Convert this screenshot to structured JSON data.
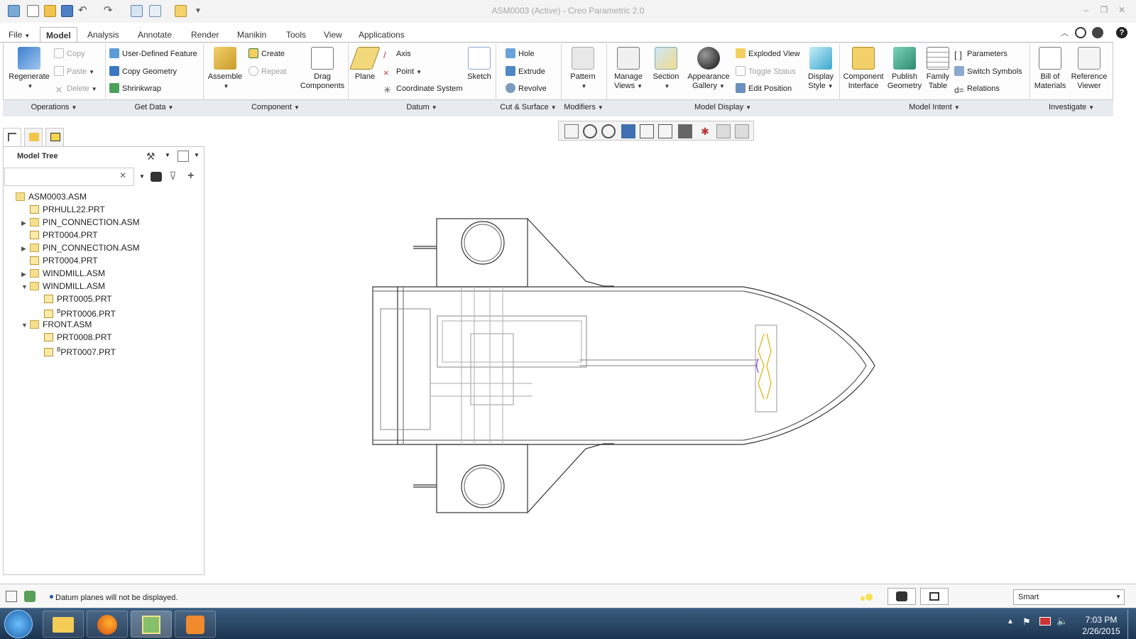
{
  "window": {
    "title": "ASM0003 (Active) - Creo Parametric 2.0"
  },
  "tabs": [
    {
      "label": "File",
      "active": false
    },
    {
      "label": "Model",
      "active": true
    },
    {
      "label": "Analysis",
      "active": false
    },
    {
      "label": "Annotate",
      "active": false
    },
    {
      "label": "Render",
      "active": false
    },
    {
      "label": "Manikin",
      "active": false
    },
    {
      "label": "Tools",
      "active": false
    },
    {
      "label": "View",
      "active": false
    },
    {
      "label": "Applications",
      "active": false
    }
  ],
  "ribbon": {
    "regenerate": "Regenerate",
    "copy": "Copy",
    "paste": "Paste",
    "delete": "Delete",
    "user_defined_feature": "User-Defined Feature",
    "copy_geometry": "Copy Geometry",
    "shrinkwrap": "Shrinkwrap",
    "assemble": "Assemble",
    "create": "Create",
    "repeat": "Repeat",
    "drag_components_1": "Drag",
    "drag_components_2": "Components",
    "plane": "Plane",
    "axis": "Axis",
    "point": "Point",
    "coordinate_system": "Coordinate System",
    "sketch": "Sketch",
    "hole": "Hole",
    "extrude": "Extrude",
    "revolve": "Revolve",
    "pattern": "Pattern",
    "manage_views_1": "Manage",
    "manage_views_2": "Views",
    "section": "Section",
    "appearance_gallery_1": "Appearance",
    "appearance_gallery_2": "Gallery",
    "exploded_view": "Exploded View",
    "toggle_status": "Toggle Status",
    "edit_position": "Edit Position",
    "display_style_1": "Display",
    "display_style_2": "Style",
    "component_interface_1": "Component",
    "component_interface_2": "Interface",
    "publish_geometry_1": "Publish",
    "publish_geometry_2": "Geometry",
    "family_table_1": "Family",
    "family_table_2": "Table",
    "parameters": "Parameters",
    "switch_symbols": "Switch Symbols",
    "relations": "Relations",
    "bill_of_materials_1": "Bill of",
    "bill_of_materials_2": "Materials",
    "reference_viewer_1": "Reference",
    "reference_viewer_2": "Viewer"
  },
  "groups": {
    "operations": "Operations",
    "get_data": "Get Data",
    "component": "Component",
    "datum": "Datum",
    "cut_surface": "Cut & Surface",
    "modifiers": "Modifiers",
    "model_display": "Model Display",
    "model_intent": "Model Intent",
    "investigate": "Investigate"
  },
  "model_tree": {
    "header": "Model Tree",
    "search_value": "",
    "items": [
      {
        "label": "ASM0003.ASM",
        "level": 0,
        "expander": "",
        "type": "asm"
      },
      {
        "label": "PRHULL22.PRT",
        "level": 1,
        "expander": "",
        "type": "part"
      },
      {
        "label": "PIN_CONNECTION.ASM",
        "level": 1,
        "expander": "▶",
        "type": "asm"
      },
      {
        "label": "PRT0004.PRT",
        "level": 1,
        "expander": "",
        "type": "part"
      },
      {
        "label": "PIN_CONNECTION.ASM",
        "level": 1,
        "expander": "▶",
        "type": "asm"
      },
      {
        "label": "PRT0004.PRT",
        "level": 1,
        "expander": "",
        "type": "part"
      },
      {
        "label": "WINDMILL.ASM",
        "level": 1,
        "expander": "▶",
        "type": "asm"
      },
      {
        "label": "WINDMILL.ASM",
        "level": 1,
        "expander": "▼",
        "type": "asm"
      },
      {
        "label": "PRT0005.PRT",
        "level": 2,
        "expander": "",
        "type": "part"
      },
      {
        "label": "PRT0006.PRT",
        "level": 2,
        "expander": "",
        "type": "part",
        "flag": "B"
      },
      {
        "label": "FRONT.ASM",
        "level": 1,
        "expander": "▼",
        "type": "asm"
      },
      {
        "label": "PRT0008.PRT",
        "level": 2,
        "expander": "",
        "type": "part"
      },
      {
        "label": "PRT0007.PRT",
        "level": 2,
        "expander": "",
        "type": "part",
        "flag": "B"
      }
    ]
  },
  "status": {
    "message": "Datum planes will not be displayed.",
    "filter": "Smart"
  },
  "taskbar": {
    "time": "7:03 PM",
    "date": "2/26/2015"
  },
  "colors": {
    "accent": "#1f57a4",
    "ribbon_bg": "#fdfdfd",
    "group_bar": "#e7eaee"
  }
}
